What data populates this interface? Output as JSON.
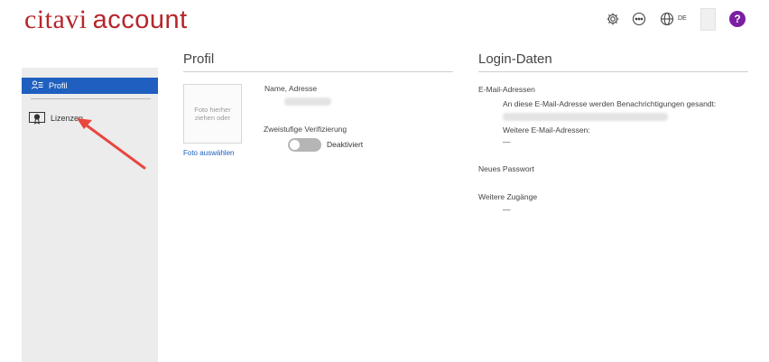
{
  "header": {
    "logo_brand": "citavi",
    "logo_suffix": "account",
    "language_code": "DE",
    "help_label": "?"
  },
  "sidebar": {
    "items": [
      {
        "label": "Profil",
        "icon": "user-list-icon",
        "active": true
      },
      {
        "label": "Lizenzen",
        "icon": "certificate-icon",
        "active": false
      }
    ]
  },
  "profil": {
    "title": "Profil",
    "photo_placeholder": "Foto hierher ziehen oder",
    "photo_link": "Foto auswählen",
    "name_link": "Name, Adresse",
    "two_factor_label": "Zweistufige Verifizierung",
    "two_factor_state": "Deaktiviert"
  },
  "login": {
    "title": "Login-Daten",
    "email_link": "E-Mail-Adressen",
    "email_notice": "An diese E-Mail-Adresse werden Benachrichtigungen gesandt:",
    "more_emails_label": "Weitere E-Mail-Adressen:",
    "more_emails_value": "—",
    "password_link": "Neues Passwort",
    "more_access_link": "Weitere Zugänge",
    "more_access_value": "—"
  },
  "colors": {
    "brand": "#b5262b",
    "accent": "#1f5fbf",
    "help": "#7b1fa2",
    "arrow": "#e8473f"
  }
}
